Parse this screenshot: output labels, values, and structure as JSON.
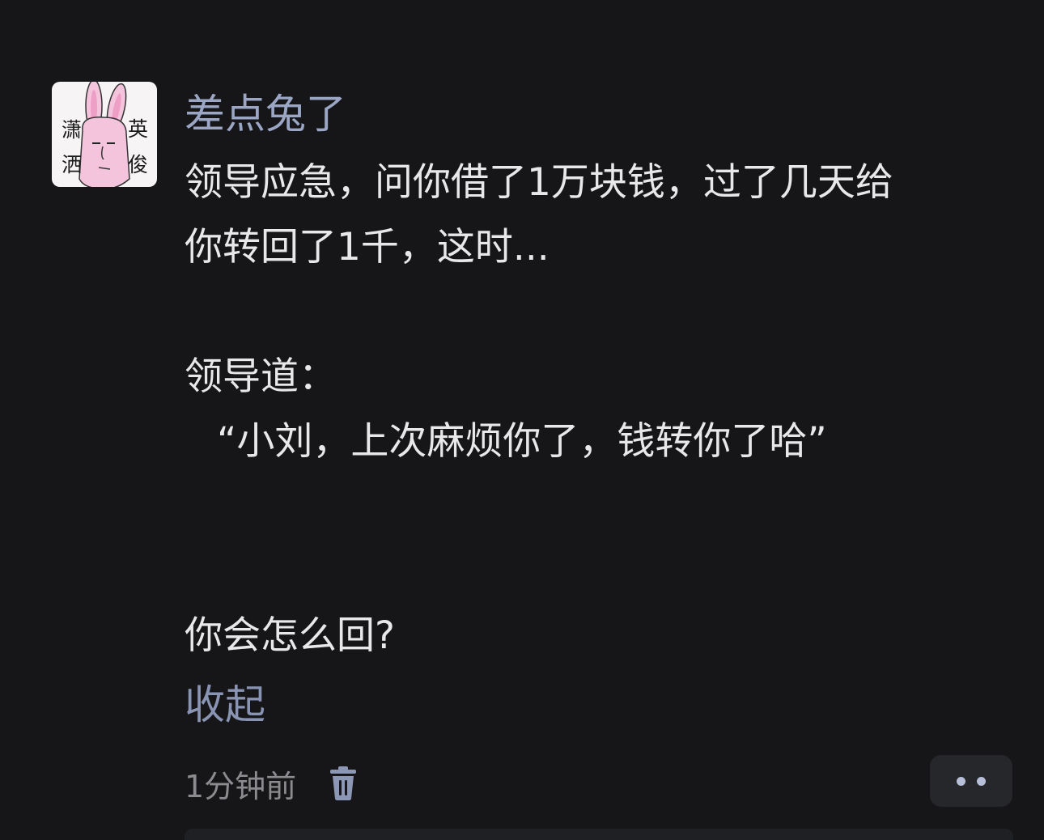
{
  "post": {
    "avatar": {
      "characters": [
        "潇",
        "洒",
        "英",
        "俊"
      ]
    },
    "username": "差点兔了",
    "content_lines": [
      "领导应急，问你借了1万块钱，过了几天给",
      "你转回了1千，这时...",
      "领导道：",
      "“小刘，上次麻烦你了，钱转你了哈”",
      "你会怎么回?"
    ],
    "collapse_label": "收起",
    "timestamp": "1分钟前",
    "icons": {
      "delete": "trash-icon",
      "more": "more-dots-icon"
    },
    "colors": {
      "background": "#161618",
      "username": "#9aa6c4",
      "collapse": "#8994b2",
      "text": "#e8e8ea"
    }
  }
}
